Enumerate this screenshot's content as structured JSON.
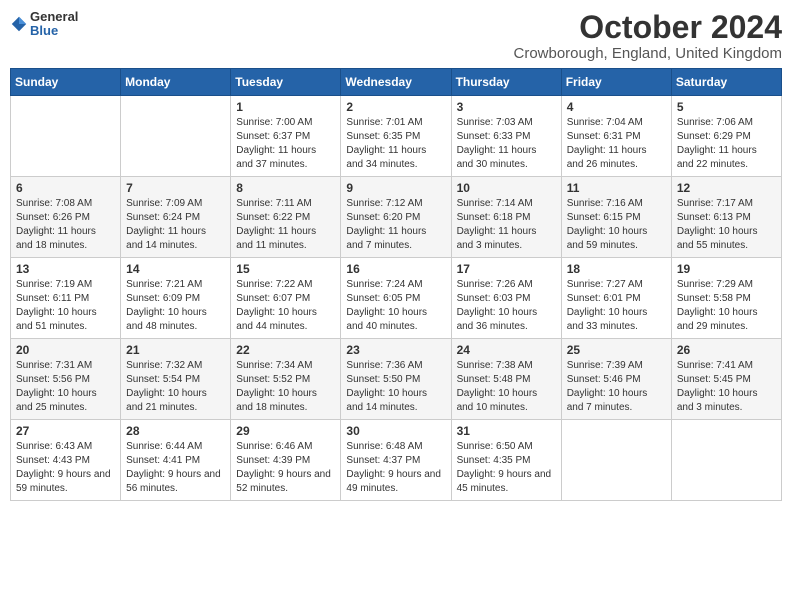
{
  "header": {
    "logo_general": "General",
    "logo_blue": "Blue",
    "month_title": "October 2024",
    "location": "Crowborough, England, United Kingdom"
  },
  "weekdays": [
    "Sunday",
    "Monday",
    "Tuesday",
    "Wednesday",
    "Thursday",
    "Friday",
    "Saturday"
  ],
  "weeks": [
    [
      {
        "day": "",
        "info": ""
      },
      {
        "day": "",
        "info": ""
      },
      {
        "day": "1",
        "info": "Sunrise: 7:00 AM\nSunset: 6:37 PM\nDaylight: 11 hours and 37 minutes."
      },
      {
        "day": "2",
        "info": "Sunrise: 7:01 AM\nSunset: 6:35 PM\nDaylight: 11 hours and 34 minutes."
      },
      {
        "day": "3",
        "info": "Sunrise: 7:03 AM\nSunset: 6:33 PM\nDaylight: 11 hours and 30 minutes."
      },
      {
        "day": "4",
        "info": "Sunrise: 7:04 AM\nSunset: 6:31 PM\nDaylight: 11 hours and 26 minutes."
      },
      {
        "day": "5",
        "info": "Sunrise: 7:06 AM\nSunset: 6:29 PM\nDaylight: 11 hours and 22 minutes."
      }
    ],
    [
      {
        "day": "6",
        "info": "Sunrise: 7:08 AM\nSunset: 6:26 PM\nDaylight: 11 hours and 18 minutes."
      },
      {
        "day": "7",
        "info": "Sunrise: 7:09 AM\nSunset: 6:24 PM\nDaylight: 11 hours and 14 minutes."
      },
      {
        "day": "8",
        "info": "Sunrise: 7:11 AM\nSunset: 6:22 PM\nDaylight: 11 hours and 11 minutes."
      },
      {
        "day": "9",
        "info": "Sunrise: 7:12 AM\nSunset: 6:20 PM\nDaylight: 11 hours and 7 minutes."
      },
      {
        "day": "10",
        "info": "Sunrise: 7:14 AM\nSunset: 6:18 PM\nDaylight: 11 hours and 3 minutes."
      },
      {
        "day": "11",
        "info": "Sunrise: 7:16 AM\nSunset: 6:15 PM\nDaylight: 10 hours and 59 minutes."
      },
      {
        "day": "12",
        "info": "Sunrise: 7:17 AM\nSunset: 6:13 PM\nDaylight: 10 hours and 55 minutes."
      }
    ],
    [
      {
        "day": "13",
        "info": "Sunrise: 7:19 AM\nSunset: 6:11 PM\nDaylight: 10 hours and 51 minutes."
      },
      {
        "day": "14",
        "info": "Sunrise: 7:21 AM\nSunset: 6:09 PM\nDaylight: 10 hours and 48 minutes."
      },
      {
        "day": "15",
        "info": "Sunrise: 7:22 AM\nSunset: 6:07 PM\nDaylight: 10 hours and 44 minutes."
      },
      {
        "day": "16",
        "info": "Sunrise: 7:24 AM\nSunset: 6:05 PM\nDaylight: 10 hours and 40 minutes."
      },
      {
        "day": "17",
        "info": "Sunrise: 7:26 AM\nSunset: 6:03 PM\nDaylight: 10 hours and 36 minutes."
      },
      {
        "day": "18",
        "info": "Sunrise: 7:27 AM\nSunset: 6:01 PM\nDaylight: 10 hours and 33 minutes."
      },
      {
        "day": "19",
        "info": "Sunrise: 7:29 AM\nSunset: 5:58 PM\nDaylight: 10 hours and 29 minutes."
      }
    ],
    [
      {
        "day": "20",
        "info": "Sunrise: 7:31 AM\nSunset: 5:56 PM\nDaylight: 10 hours and 25 minutes."
      },
      {
        "day": "21",
        "info": "Sunrise: 7:32 AM\nSunset: 5:54 PM\nDaylight: 10 hours and 21 minutes."
      },
      {
        "day": "22",
        "info": "Sunrise: 7:34 AM\nSunset: 5:52 PM\nDaylight: 10 hours and 18 minutes."
      },
      {
        "day": "23",
        "info": "Sunrise: 7:36 AM\nSunset: 5:50 PM\nDaylight: 10 hours and 14 minutes."
      },
      {
        "day": "24",
        "info": "Sunrise: 7:38 AM\nSunset: 5:48 PM\nDaylight: 10 hours and 10 minutes."
      },
      {
        "day": "25",
        "info": "Sunrise: 7:39 AM\nSunset: 5:46 PM\nDaylight: 10 hours and 7 minutes."
      },
      {
        "day": "26",
        "info": "Sunrise: 7:41 AM\nSunset: 5:45 PM\nDaylight: 10 hours and 3 minutes."
      }
    ],
    [
      {
        "day": "27",
        "info": "Sunrise: 6:43 AM\nSunset: 4:43 PM\nDaylight: 9 hours and 59 minutes."
      },
      {
        "day": "28",
        "info": "Sunrise: 6:44 AM\nSunset: 4:41 PM\nDaylight: 9 hours and 56 minutes."
      },
      {
        "day": "29",
        "info": "Sunrise: 6:46 AM\nSunset: 4:39 PM\nDaylight: 9 hours and 52 minutes."
      },
      {
        "day": "30",
        "info": "Sunrise: 6:48 AM\nSunset: 4:37 PM\nDaylight: 9 hours and 49 minutes."
      },
      {
        "day": "31",
        "info": "Sunrise: 6:50 AM\nSunset: 4:35 PM\nDaylight: 9 hours and 45 minutes."
      },
      {
        "day": "",
        "info": ""
      },
      {
        "day": "",
        "info": ""
      }
    ]
  ]
}
